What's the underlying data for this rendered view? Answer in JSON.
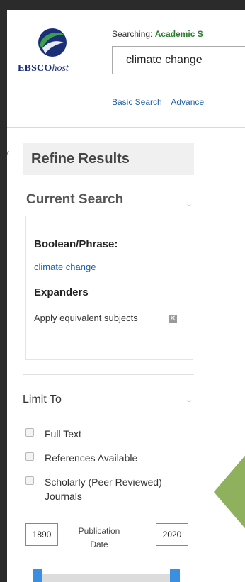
{
  "header": {
    "logo": {
      "brand": "EBSCO",
      "suffix": "host",
      "icon": "ebsco-logo-icon"
    },
    "searching_prefix": "Searching: ",
    "database": "Academic S",
    "search_value": "climate change",
    "links": [
      "Basic Search",
      "Advance"
    ]
  },
  "sidebar": {
    "collapse_icon": "collapse-x-icon",
    "title": "Refine Results",
    "current_search": {
      "title": "Current Search",
      "boolean_label": "Boolean/Phrase:",
      "boolean_value": "climate change",
      "expanders_label": "Expanders",
      "expander_value": "Apply equivalent subjects",
      "remove_icon": "remove-x-icon"
    },
    "limit_to": {
      "title": "Limit To",
      "options": [
        {
          "label": "Full Text",
          "checked": false
        },
        {
          "label": "References Available",
          "checked": false
        },
        {
          "label": "Scholarly (Peer Reviewed)",
          "label2": "Journals",
          "checked": false
        }
      ],
      "publication_date": {
        "label_line1": "Publication",
        "label_line2": "Date",
        "from": "1890",
        "to": "2020"
      }
    }
  },
  "colors": {
    "accent_blue": "#3a8fe0",
    "link_blue": "#1f5fa8",
    "database_green": "#2e7d32",
    "pointer_green": "#8fb15e",
    "outer_bg": "#2b2b2b"
  }
}
